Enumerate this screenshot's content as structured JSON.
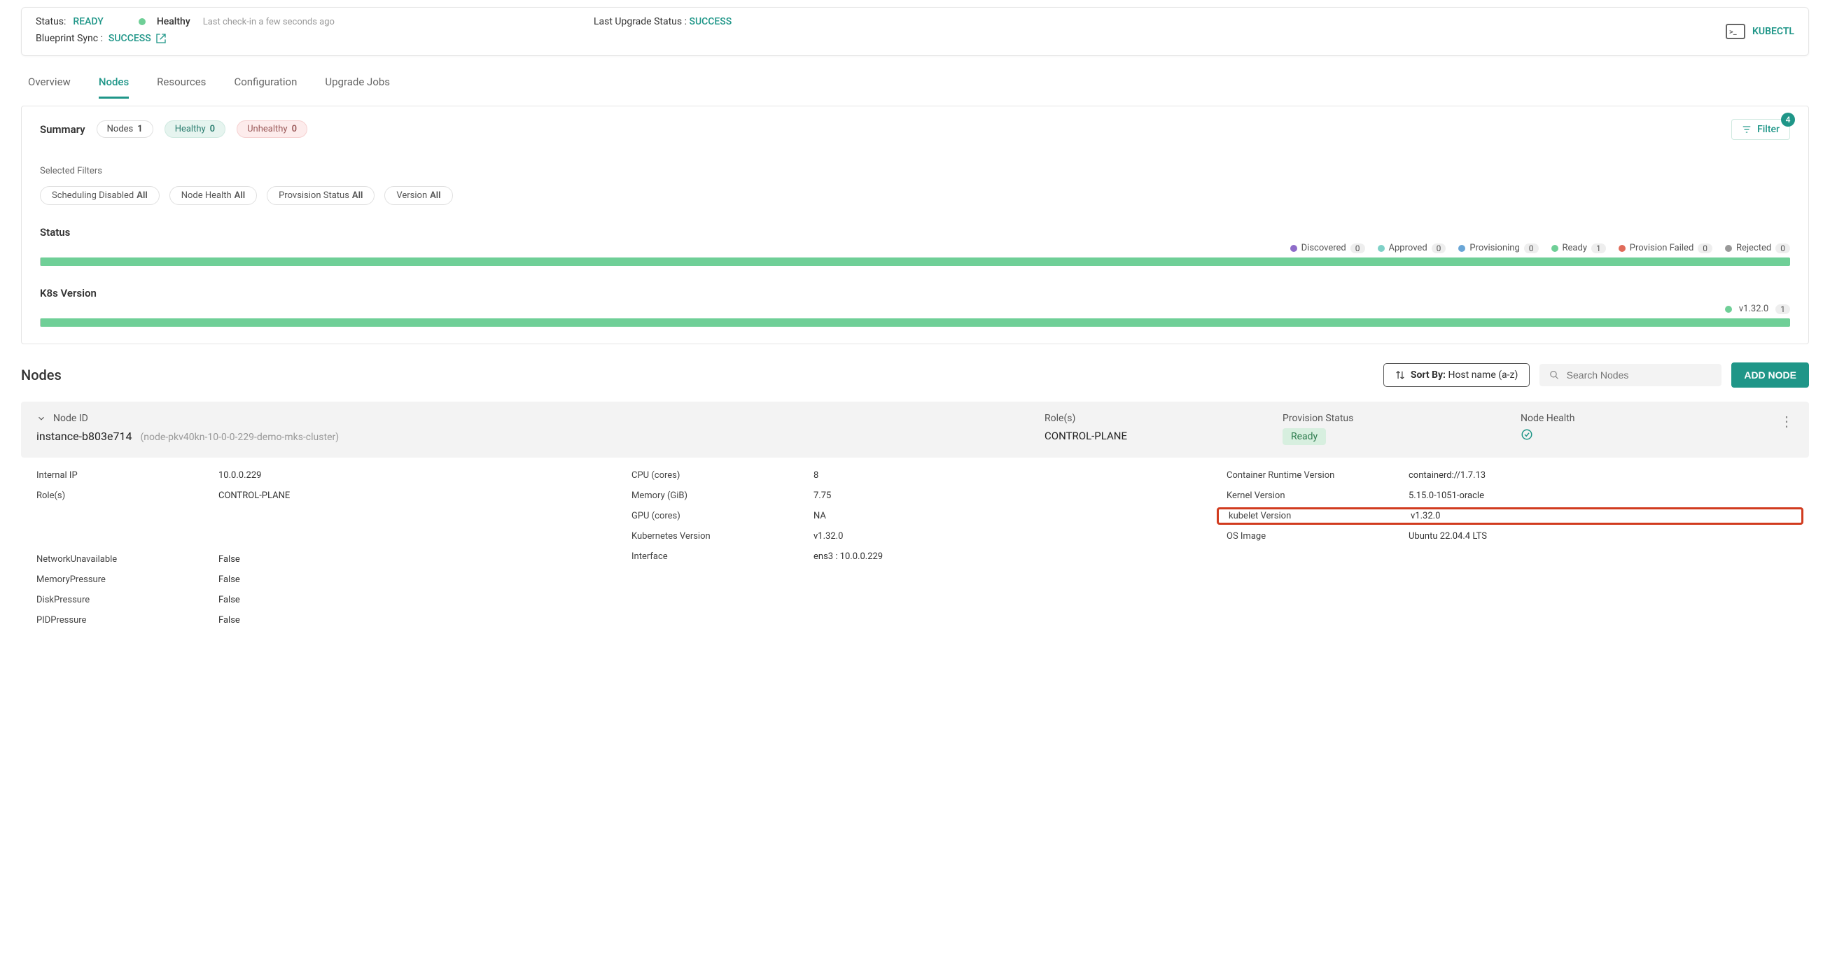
{
  "header": {
    "status_label": "Status:",
    "status_value": "READY",
    "health_text": "Healthy",
    "checkin_text": "Last check-in a few seconds ago",
    "last_upgrade_label": "Last Upgrade Status :",
    "last_upgrade_value": "SUCCESS",
    "blueprint_label": "Blueprint Sync :",
    "blueprint_value": "SUCCESS",
    "kubectl_label": "KUBECTL"
  },
  "tabs": {
    "overview": "Overview",
    "nodes": "Nodes",
    "resources": "Resources",
    "configuration": "Configuration",
    "upgrade_jobs": "Upgrade Jobs"
  },
  "summary": {
    "title": "Summary",
    "nodes_label": "Nodes",
    "nodes_count": "1",
    "healthy_label": "Healthy",
    "healthy_count": "0",
    "unhealthy_label": "Unhealthy",
    "unhealthy_count": "0",
    "filter_label": "Filter",
    "filter_count": "4"
  },
  "filters": {
    "title": "Selected Filters",
    "c1_label": "Scheduling Disabled",
    "c1_val": "All",
    "c2_label": "Node Health",
    "c2_val": "All",
    "c3_label": "Provsision Status",
    "c3_val": "All",
    "c4_label": "Version",
    "c4_val": "All"
  },
  "status_section": {
    "title": "Status",
    "legend": {
      "discovered_label": "Discovered",
      "discovered_count": "0",
      "approved_label": "Approved",
      "approved_count": "0",
      "provisioning_label": "Provisioning",
      "provisioning_count": "0",
      "ready_label": "Ready",
      "ready_count": "1",
      "failed_label": "Provision Failed",
      "failed_count": "0",
      "rejected_label": "Rejected",
      "rejected_count": "0"
    }
  },
  "k8s_section": {
    "title": "K8s Version",
    "version_label": "v1.32.0",
    "version_count": "1"
  },
  "nodes_section": {
    "title": "Nodes",
    "sort_label": "Sort By:",
    "sort_value": "Host name (a-z)",
    "search_placeholder": "Search Nodes",
    "add_node_label": "ADD NODE"
  },
  "node": {
    "header": {
      "node_id_label": "Node ID",
      "name": "instance-b803e714",
      "subname": "(node-pkv40kn-10-0-0-229-demo-mks-cluster)",
      "roles_label": "Role(s)",
      "roles_value": "CONTROL-PLANE",
      "provision_label": "Provision Status",
      "provision_value": "Ready",
      "health_label": "Node Health"
    },
    "body": {
      "col1": {
        "internal_ip_k": "Internal IP",
        "internal_ip_v": "10.0.0.229",
        "roles_k": "Role(s)",
        "roles_v": "CONTROL-PLANE",
        "net_k": "NetworkUnavailable",
        "net_v": "False",
        "mem_k": "MemoryPressure",
        "mem_v": "False",
        "disk_k": "DiskPressure",
        "disk_v": "False",
        "pid_k": "PIDPressure",
        "pid_v": "False"
      },
      "col2": {
        "cpu_k": "CPU (cores)",
        "cpu_v": "8",
        "mem_k": "Memory (GiB)",
        "mem_v": "7.75",
        "gpu_k": "GPU (cores)",
        "gpu_v": "NA",
        "k8s_k": "Kubernetes Version",
        "k8s_v": "v1.32.0",
        "if_k": "Interface",
        "if_v": "ens3 : 10.0.0.229"
      },
      "col3": {
        "crt_k": "Container Runtime Version",
        "crt_v": "containerd://1.7.13",
        "kernel_k": "Kernel Version",
        "kernel_v": "5.15.0-1051-oracle",
        "kubelet_k": "kubelet Version",
        "kubelet_v": "v1.32.0",
        "os_k": "OS Image",
        "os_v": "Ubuntu 22.04.4 LTS"
      }
    }
  }
}
